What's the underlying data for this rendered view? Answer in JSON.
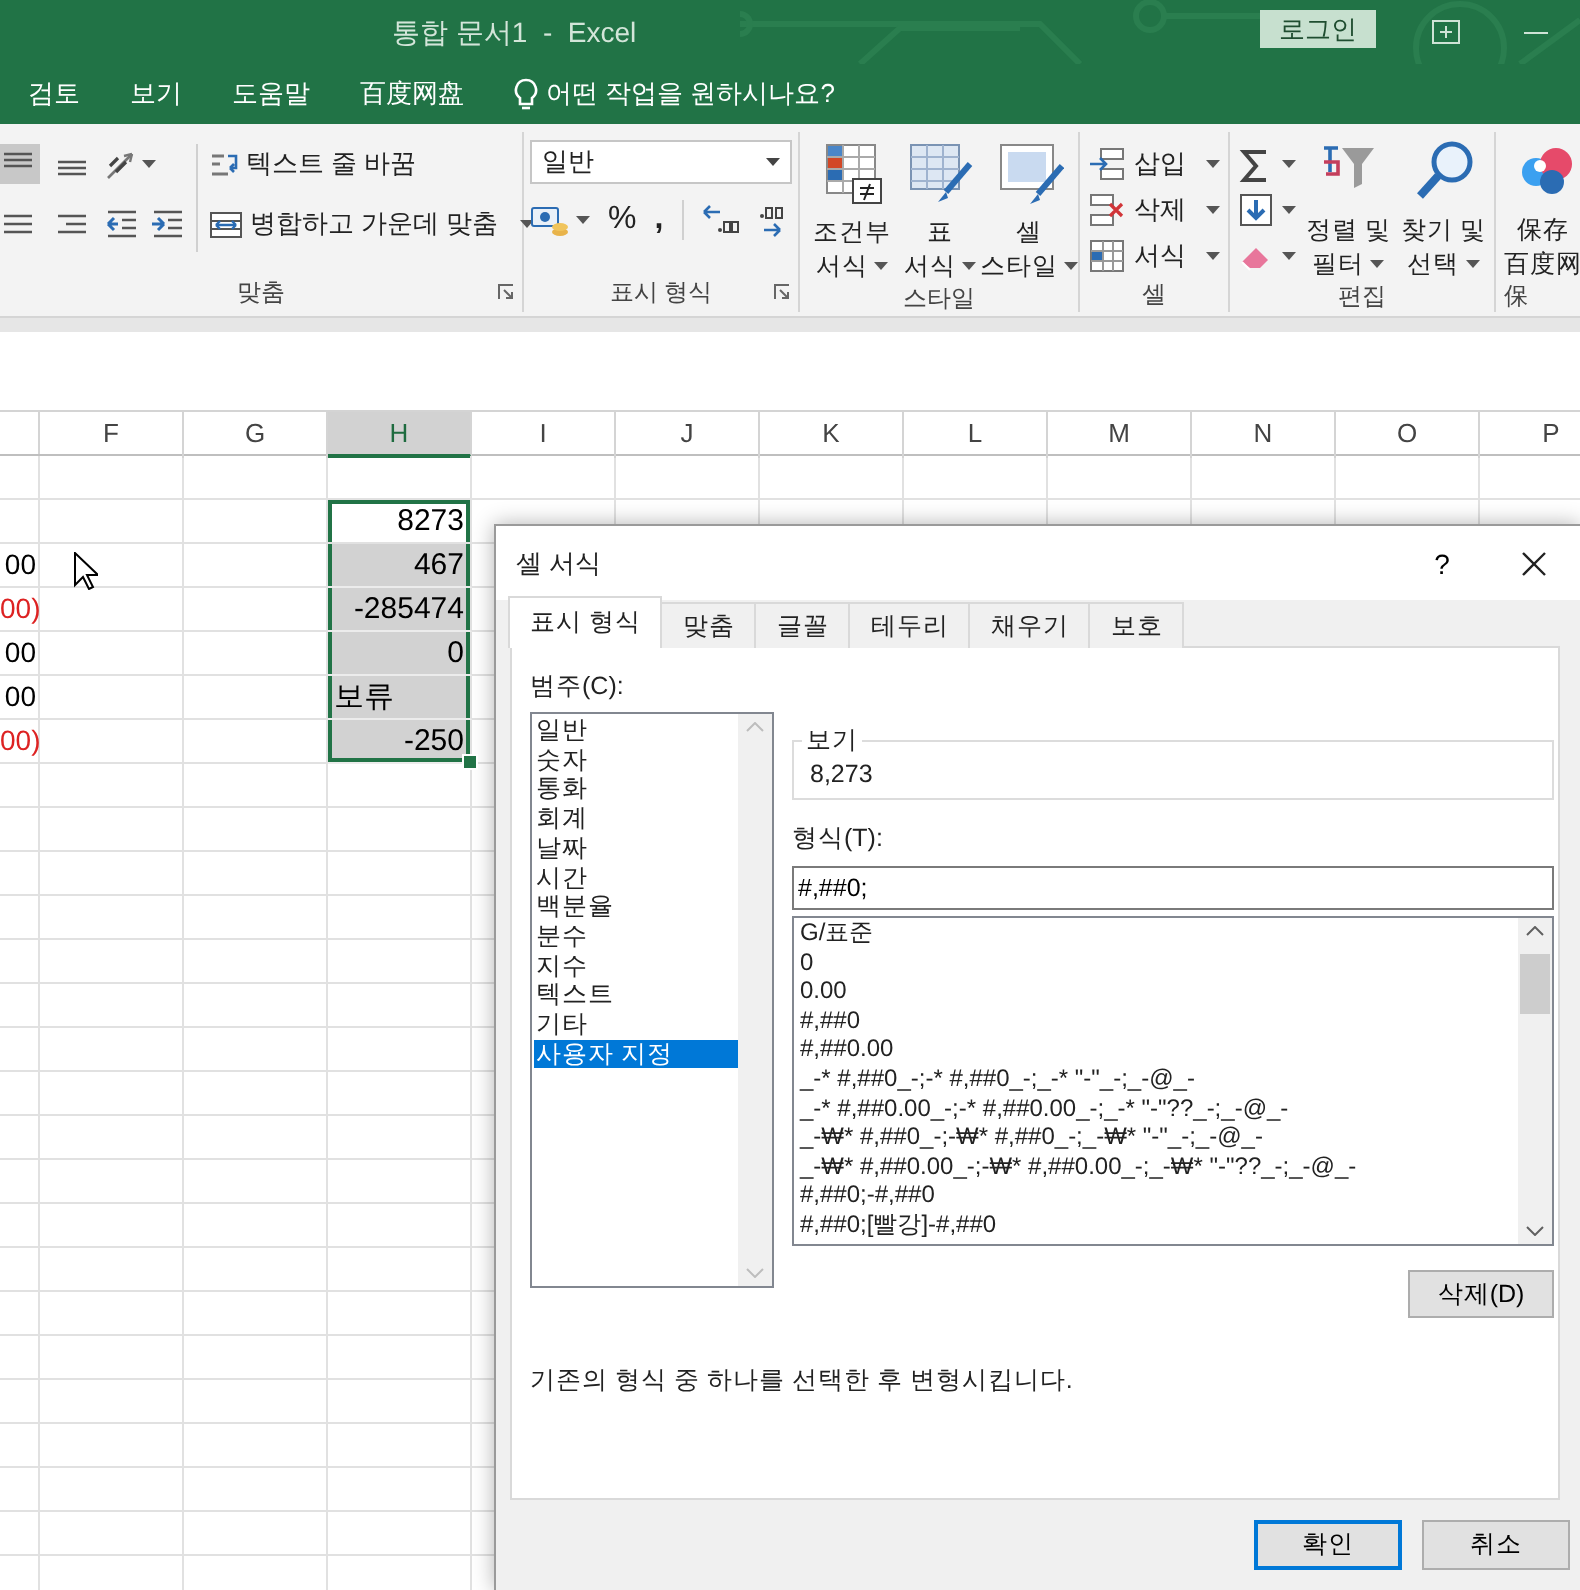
{
  "window": {
    "title": "통합 문서1  -  Excel",
    "login_button": "로그인"
  },
  "menu_tabs": [
    {
      "label": "검토"
    },
    {
      "label": "보기"
    },
    {
      "label": "도움말"
    },
    {
      "label": "百度网盘"
    }
  ],
  "tell_me": "어떤 작업을 원하시나요?",
  "ribbon": {
    "groups": [
      {
        "kind": "alignment",
        "label": "맞춤",
        "alignment_buttons": [
          {
            "selected": true
          },
          {
            "selected": false
          },
          {
            "selected": false
          },
          {
            "selected": false
          }
        ],
        "wrap_text": "텍스트 줄 바꿈",
        "merge_center": "병합하고 가운데 맞춤"
      },
      {
        "kind": "number",
        "label": "표시 형식",
        "format": "일반",
        "percent": "%",
        "comma": ","
      },
      {
        "kind": "styles",
        "label": "스타일",
        "buttons": [
          {
            "lines": [
              "조건부",
              "서식"
            ]
          },
          {
            "lines": [
              "표",
              "서식"
            ]
          },
          {
            "lines": [
              "셀",
              "스타일"
            ]
          }
        ]
      },
      {
        "kind": "cells",
        "label": "셀",
        "buttons": [
          {
            "label": "삽입"
          },
          {
            "label": "삭제"
          },
          {
            "label": "서식"
          }
        ]
      },
      {
        "kind": "editing",
        "label": "편집",
        "buttons": [
          {
            "lines": [
              "정렬 및",
              "필터"
            ]
          },
          {
            "lines": [
              "찾기 및",
              "선택"
            ]
          }
        ]
      },
      {
        "kind": "baidu",
        "label": "保",
        "lines": [
          "保存",
          "百度网"
        ]
      }
    ]
  },
  "sheet": {
    "columns": [
      {
        "label": "F",
        "selected": false
      },
      {
        "label": "G",
        "selected": false
      },
      {
        "label": "H",
        "selected": true
      },
      {
        "label": "I",
        "selected": false
      },
      {
        "label": "J",
        "selected": false
      },
      {
        "label": "K",
        "selected": false
      },
      {
        "label": "L",
        "selected": false
      },
      {
        "label": "M",
        "selected": false
      },
      {
        "label": "N",
        "selected": false
      },
      {
        "label": "O",
        "selected": false
      },
      {
        "label": "P",
        "selected": false
      }
    ],
    "rows": [
      {
        "column_h": {
          "selected": false
        }
      },
      {
        "column_h": {
          "text": "8273",
          "kind": "number",
          "selected": true,
          "active": true
        }
      },
      {
        "column_e": {
          "text": "00",
          "negative": false
        },
        "column_h": {
          "text": "467",
          "kind": "number",
          "selected": true,
          "active": false
        }
      },
      {
        "column_e": {
          "text": "00)",
          "negative": true
        },
        "column_h": {
          "text": "-285474",
          "kind": "number",
          "selected": true,
          "active": false
        }
      },
      {
        "column_e": {
          "text": "00",
          "negative": false
        },
        "column_h": {
          "text": "0",
          "kind": "number",
          "selected": true,
          "active": false
        }
      },
      {
        "column_e": {
          "text": "00",
          "negative": false
        },
        "column_h": {
          "text": "보류",
          "kind": "text",
          "selected": true,
          "active": false
        }
      },
      {
        "column_e": {
          "text": "00)",
          "negative": true
        },
        "column_h": {
          "text": "-250",
          "kind": "number",
          "selected": true,
          "active": false
        }
      }
    ]
  },
  "dialog": {
    "title": "셀 서식",
    "help": "?",
    "tabs": [
      {
        "label": "표시 형식",
        "selected": true
      },
      {
        "label": "맞춤",
        "selected": false
      },
      {
        "label": "글꼴",
        "selected": false
      },
      {
        "label": "테두리",
        "selected": false
      },
      {
        "label": "채우기",
        "selected": false
      },
      {
        "label": "보호",
        "selected": false
      }
    ],
    "category_label": "범주(C):",
    "categories": [
      {
        "label": "일반",
        "selected": false
      },
      {
        "label": "숫자",
        "selected": false
      },
      {
        "label": "통화",
        "selected": false
      },
      {
        "label": "회계",
        "selected": false
      },
      {
        "label": "날짜",
        "selected": false
      },
      {
        "label": "시간",
        "selected": false
      },
      {
        "label": "백분율",
        "selected": false
      },
      {
        "label": "분수",
        "selected": false
      },
      {
        "label": "지수",
        "selected": false
      },
      {
        "label": "텍스트",
        "selected": false
      },
      {
        "label": "기타",
        "selected": false
      },
      {
        "label": "사용자 지정",
        "selected": true
      }
    ],
    "sample_label": "보기",
    "sample": "8,273",
    "type_label": "형식(T):",
    "type_value": "#,##0;",
    "formats": [
      "G/표준",
      "0",
      "0.00",
      "#,##0",
      "#,##0.00",
      "_-* #,##0_-;-* #,##0_-;_-* \"-\"_-;_-@_-",
      "_-* #,##0.00_-;-* #,##0.00_-;_-* \"-\"??_-;_-@_-",
      "_-₩* #,##0_-;-₩* #,##0_-;_-₩* \"-\"_-;_-@_-",
      "_-₩* #,##0.00_-;-₩* #,##0.00_-;_-₩* \"-\"??_-;_-@_-",
      "#,##0;-#,##0",
      "#,##0;[빨강]-#,##0"
    ],
    "delete_button": "삭제(D)",
    "description": "기존의 형식 중 하나를 선택한 후 변형시킵니다.",
    "ok_button": "확인",
    "cancel_button": "취소"
  }
}
